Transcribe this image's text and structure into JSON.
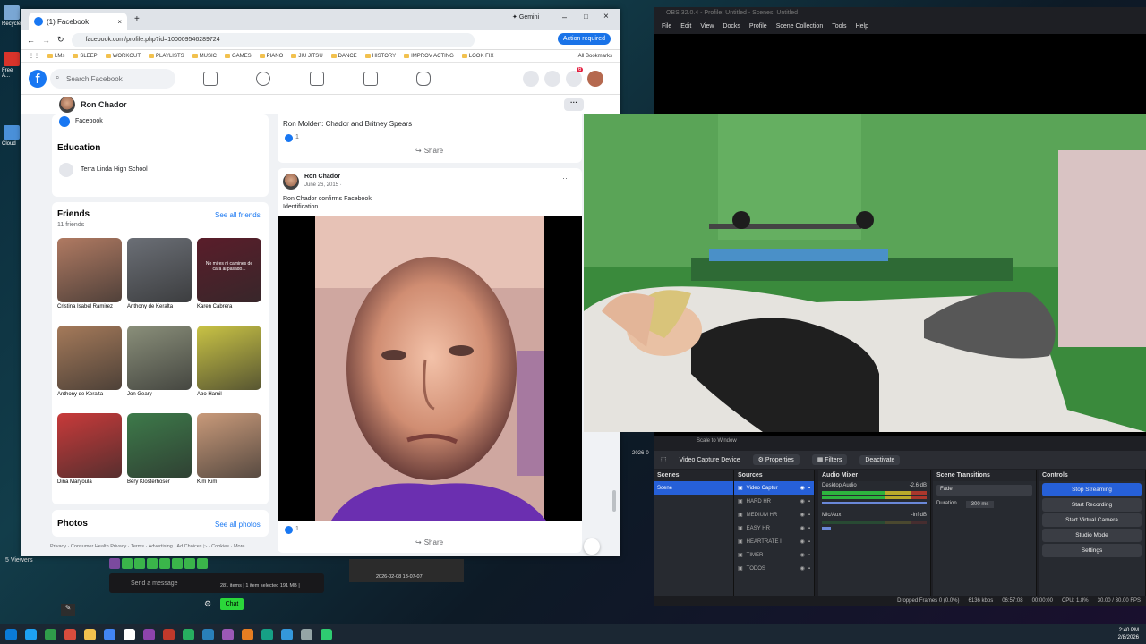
{
  "desktop": {
    "icons": [
      {
        "label": "Recycle",
        "color": "#7aa7d4"
      },
      {
        "label": "Free A...",
        "color": "#d9342b"
      },
      {
        "label": "Cloud",
        "color": "#4a90d9"
      }
    ],
    "viewers_label": "5 Viewers"
  },
  "chrome": {
    "tab_title": "(1) Facebook",
    "gemini_label": "Gemini",
    "url": "facebook.com/profile.php?id=100009546289724",
    "action_required": "Action required",
    "bookmarks": [
      "LMs",
      "SLEEP",
      "WORKOUT",
      "PLAYLISTS",
      "MUSIC",
      "GAMES",
      "PIANO",
      "JIU JITSU",
      "DANCE",
      "HISTORY",
      "IMPROV ACTING",
      "LOOK FIX"
    ],
    "all_bookmarks": "All Bookmarks"
  },
  "facebook": {
    "search_placeholder": "Search Facebook",
    "notification_count": "6",
    "profile_name": "Ron Chador",
    "intro_fragment": "Facebook",
    "education_heading": "Education",
    "school": "Terra Linda High School",
    "friends_heading": "Friends",
    "friends_count": "11 friends",
    "see_all_friends": "See all friends",
    "friends": [
      {
        "name": "Cristina Isabel Ramirez",
        "tone": "#b07a62"
      },
      {
        "name": "Anthony de Keralta",
        "tone": "#6b6f76"
      },
      {
        "name": "Karen Cabrera",
        "tone": "#5a1d2a"
      },
      {
        "name": "Anthony de Keralta",
        "tone": "#a57a5a"
      },
      {
        "name": "Jon Geary",
        "tone": "#8a8f7a"
      },
      {
        "name": "Abo Hamil",
        "tone": "#c9c345"
      },
      {
        "name": "Dina Maryoula",
        "tone": "#c83a3a"
      },
      {
        "name": "Bery Klosterhoser",
        "tone": "#3d7a4a"
      },
      {
        "name": "Kim Kim",
        "tone": "#c99a7a"
      }
    ],
    "karen_card_text": "No mires ni camines de cara al pasado...",
    "photos_heading": "Photos",
    "see_all_photos": "See all photos",
    "footer_links": "Privacy · Consumer Health Privacy · Terms · Advertising · Ad Choices ▷ · Cookies · More",
    "prev_post_title": "Ron Molden: Chador and Britney Spears",
    "like_count": "1",
    "share_label": "Share",
    "post": {
      "author": "Ron Chador",
      "date": "June 26, 2015 · ",
      "text": "Ron Chador confirms Facebook Identification",
      "like_count": "1",
      "share_label": "Share"
    }
  },
  "obs": {
    "title": "OBS 32.0.4 - Profile: Untitled - Scenes: Untitled",
    "menu": [
      "File",
      "Edit",
      "View",
      "Docks",
      "Profile",
      "Scene Collection",
      "Tools",
      "Help"
    ],
    "scale_label": "Scale to Window",
    "source_name": "Video Capture Device",
    "properties": "Properties",
    "filters": "Filters",
    "deactivate": "Deactivate",
    "docks": {
      "scenes_title": "Scenes",
      "scenes": [
        "Scene"
      ],
      "sources_title": "Sources",
      "sources": [
        "Video Captur",
        "HARD HR",
        "MEDIUM HR",
        "EASY HR",
        "HEARTRATE I",
        "TIMER",
        "TODOS"
      ],
      "mixer_title": "Audio Mixer",
      "mixer": [
        {
          "name": "Desktop Audio",
          "db": "-2.6 dB"
        },
        {
          "name": "Mic/Aux",
          "db": "-inf dB"
        }
      ],
      "transitions_title": "Scene Transitions",
      "transition": "Fade",
      "duration_label": "Duration",
      "duration_value": "300 ms",
      "controls_title": "Controls",
      "controls": [
        "Stop Streaming",
        "Start Recording",
        "Start Virtual Camera",
        "Studio Mode",
        "Settings"
      ]
    },
    "status": {
      "dropped": "Dropped Frames 0 (0.0%)",
      "bitrate": "6136 kbps",
      "stream_time": "06:57:08",
      "rec_time": "00:00:00",
      "cpu": "CPU: 1.8%",
      "fps": "30.00 / 30.00 FPS"
    }
  },
  "overlay": {
    "chat_placeholder": "Send a message",
    "chat_button": "Chat",
    "explorer_status": "281 items  |  1 item selected  191 MB  |",
    "thumb_timestamp": "2026-02-08 13-07-07",
    "side_date": "2026-0"
  },
  "taskbar": {
    "icons": [
      "#0a7bd8",
      "#1da1f2",
      "#2f9d4a",
      "#d94c3d",
      "#f2c14e",
      "#4285f4",
      "#ffffff",
      "#8e44ad",
      "#c0392b",
      "#27ae60",
      "#2980b9",
      "#9b59b6",
      "#e67e22",
      "#16a085",
      "#3498db",
      "#95a5a6",
      "#2ecc71"
    ],
    "time": "2:40 PM",
    "date": "2/8/2026"
  }
}
